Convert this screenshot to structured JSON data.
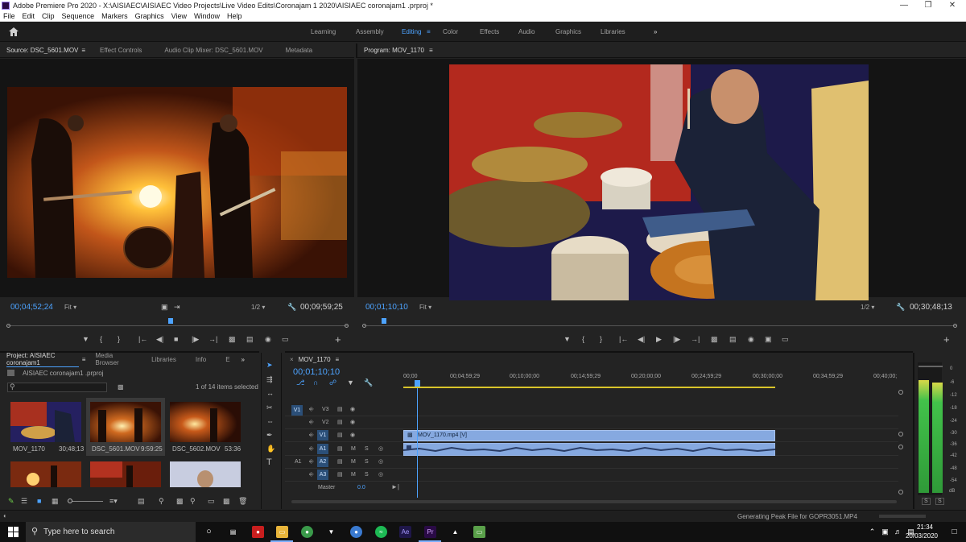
{
  "window": {
    "title": "Adobe Premiere Pro 2020 - X:\\AISIAEC\\AISIAEC Video Projects\\Live Video Edits\\Coronajam 1 2020\\AISIAEC coronajam1 .prproj *"
  },
  "menu": [
    "File",
    "Edit",
    "Clip",
    "Sequence",
    "Markers",
    "Graphics",
    "View",
    "Window",
    "Help"
  ],
  "workspaces": [
    "Learning",
    "Assembly",
    "Editing",
    "Color",
    "Effects",
    "Audio",
    "Graphics",
    "Libraries"
  ],
  "workspace_overflow": "»",
  "source": {
    "tabs": [
      "Source: DSC_5601.MOV",
      "Effect Controls",
      "Audio Clip Mixer: DSC_5601.MOV",
      "Metadata"
    ],
    "timecode": "00;04;52;24",
    "fit": "Fit",
    "resolution": "1/2",
    "duration": "00;09;59;25"
  },
  "program": {
    "tab": "Program: MOV_1170",
    "timecode": "00;01;10;10",
    "fit": "Fit",
    "resolution": "1/2",
    "duration": "00;30;48;13"
  },
  "project": {
    "tabs": [
      "Project: AISIAEC coronajam1",
      "Media Browser",
      "Libraries",
      "Info",
      "E"
    ],
    "file": "AISIAEC coronajam1 .prproj",
    "items_count": "1 of 14 items selected",
    "clips": [
      {
        "name": "MOV_1170",
        "duration": "30;48;13"
      },
      {
        "name": "DSC_5601.MOV",
        "duration": "9:59:25"
      },
      {
        "name": "DSC_5602.MOV",
        "duration": "53:36"
      }
    ]
  },
  "timeline": {
    "tab": "MOV_1170",
    "timecode": "00;01;10;10",
    "ruler": [
      "00;00",
      "00;04;59;29",
      "00;10;00;00",
      "00;14;59;29",
      "00;20;00;00",
      "00;24;59;29",
      "00;30;00;00",
      "00;34;59;29",
      "00;40;00;"
    ],
    "video_tracks": [
      "V3",
      "V2",
      "V1"
    ],
    "audio_tracks": [
      "A1",
      "A2",
      "A3"
    ],
    "source_v": "V1",
    "source_a": "A1",
    "master_label": "Master",
    "master_value": "0.0",
    "video_clip": "MOV_1170.mp4 [V]",
    "m_label": "M",
    "s_label": "S"
  },
  "meter_scale": [
    "0",
    "-6",
    "-12",
    "-18",
    "-24",
    "-30",
    "-36",
    "-42",
    "-48",
    "-54",
    "dB"
  ],
  "meter_levels": [
    0.88,
    0.86
  ],
  "status_text": "Generating Peak File for GOPR3051.MP4",
  "taskbar": {
    "search_placeholder": "Type here to search",
    "time": "21:34",
    "date": "20/03/2020"
  }
}
